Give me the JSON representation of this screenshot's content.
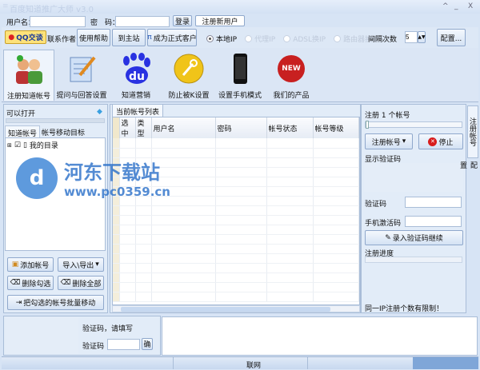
{
  "window": {
    "title": "百度知道推广大师 v3.0",
    "min": "_",
    "max": "^",
    "close": "X"
  },
  "login": {
    "username_label": "用户名：",
    "username_value": "",
    "password_label": "密　码：",
    "password_value": "",
    "login_button": "登录",
    "register_button": "注册新用户"
  },
  "toolbar": {
    "qq_button": "QQ交谈",
    "contact_author": "联系作者",
    "help": "使用帮助",
    "home": "到主站",
    "become_customer": "成为正式客户",
    "ip_options": [
      {
        "label": "本地IP",
        "selected": true,
        "enabled": true
      },
      {
        "label": "代理IP",
        "selected": false,
        "enabled": false
      },
      {
        "label": "ADSL换IP",
        "selected": false,
        "enabled": false
      },
      {
        "label": "路由器换IP",
        "selected": false,
        "enabled": false
      }
    ],
    "interval_label": "间隔次数",
    "interval_value": "5",
    "config_button": "配置..."
  },
  "big_buttons": [
    {
      "label": "注册知道帐号",
      "selected": true
    },
    {
      "label": "提问与回答设置"
    },
    {
      "label": "知道营销"
    },
    {
      "label": "防止被K设置"
    },
    {
      "label": "设置手机模式"
    },
    {
      "label": "我们的产品",
      "badge": "NEW"
    }
  ],
  "left": {
    "header": "可以打开",
    "tabs": [
      "知道帐号",
      "帐号移动目标"
    ],
    "tree_root": "我的目录",
    "buttons": {
      "add": "添加帐号",
      "import_export": "导入\\导出",
      "delete_checked": "删除勾选",
      "delete_all": "删除全部",
      "batch_move": "把勾选的帐号批量移动"
    }
  },
  "center": {
    "tab": "当前帐号列表",
    "columns": [
      "选中",
      "类型",
      "用户名",
      "密码",
      "帐号状态",
      "帐号等级"
    ]
  },
  "right": {
    "register_count": "注册 1 个帐号",
    "register_button": "注册帐号",
    "stop_button": "停止",
    "captcha_display": "显示验证码",
    "captcha_label": "验证码",
    "captcha_value": "",
    "phone_code_label": "手机激活码",
    "phone_code_value": "",
    "submit_captcha": "录入验证码继续",
    "progress_label": "注册进度",
    "progress": 0,
    "note": "同一IP注册个数有限制！",
    "vtabs": [
      "注册帐号",
      "配置"
    ]
  },
  "bottom": {
    "prompt": "验证码，请填写",
    "captcha_label": "验证码",
    "captcha_value": "",
    "ok_button": "确"
  },
  "status": {
    "network": "联网"
  },
  "watermark": {
    "name": "河东下载站",
    "url": "www.pc0359.cn"
  }
}
